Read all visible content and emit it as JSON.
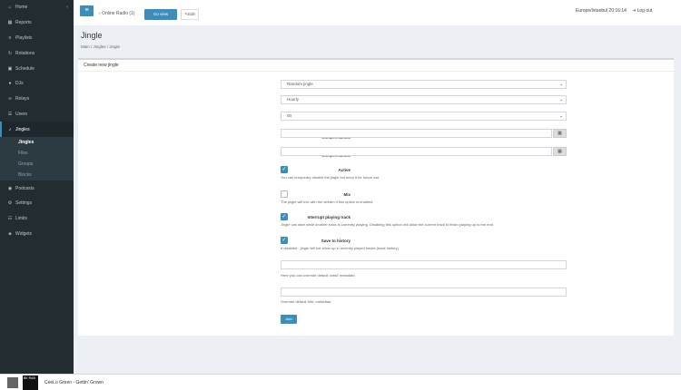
{
  "sidebar": {
    "items": [
      {
        "label": "Home",
        "icon": "house-icon"
      },
      {
        "label": "Reports",
        "icon": "chart-icon"
      },
      {
        "label": "Playlists",
        "icon": "list-icon"
      },
      {
        "label": "Rotations",
        "icon": "refresh-icon"
      },
      {
        "label": "Schedule",
        "icon": "calendar-icon"
      },
      {
        "label": "DJs",
        "icon": "user-icon"
      },
      {
        "label": "Relays",
        "icon": "link-icon"
      },
      {
        "label": "Users",
        "icon": "users-icon"
      },
      {
        "label": "Jingles",
        "icon": "bell-icon"
      },
      {
        "label": "Podcasts",
        "icon": "podcast-icon"
      },
      {
        "label": "Settings",
        "icon": "gear-icon"
      },
      {
        "label": "Limits",
        "icon": "sliders-icon"
      },
      {
        "label": "Widgets",
        "icon": "widget-icon"
      }
    ],
    "jingles_sub": [
      "Jingles",
      "Files",
      "Groups",
      "Blocks"
    ]
  },
  "topbar": {
    "radio": "Online Radio (1)",
    "view_label": "Go view",
    "edit_label": "Edit",
    "clock": "Europe/Istanbul 20:16:14",
    "logout": "Log out"
  },
  "page": {
    "title": "Jingle",
    "breadcrumb": "Main  /  Jingles  /  Jingle"
  },
  "form": {
    "box_title": "Create new jingle",
    "select_jingle_label": "Select jingle",
    "select_jingle_value": "Random jingle",
    "type_label": "Type",
    "type_value": "Hourly",
    "time_label": "Time of every hour (minutes)",
    "time_value": "00",
    "rot_start_label": "Rotation start datetime",
    "rot_start_tz": "Europe/Istanbul",
    "rot_end_label": "Rotation end datetime",
    "rot_end_tz": "Europe/Istanbul",
    "active_label": "Active",
    "active_help": "You can temporary disable the jingle but keep it for future use",
    "mix_label": "Mix",
    "mix_help": "The jingle will mix with the stream if this option is enabled",
    "interrupt_label": "Interrupt playing track",
    "interrupt_help": "Jingle can start while another track is currently playing. Disabling this option will allow the current track to finish playing up to the end",
    "history_label": "Save to history",
    "history_help": "If disabled - jingle will not show up in recently played tracks (track history)",
    "artist_label": "Custom artist meta",
    "artist_help": "Here you can override default 'artist' metadata",
    "title_label": "Custom title meta",
    "title_help": "Override default 'title' metadata",
    "add_label": "Add"
  },
  "player": {
    "cover_text": "BK RAB",
    "track": "CeeLo Green - Gettin' Grown"
  },
  "colors": {
    "accent": "#3c8dbc",
    "sidebar": "#222d32"
  }
}
